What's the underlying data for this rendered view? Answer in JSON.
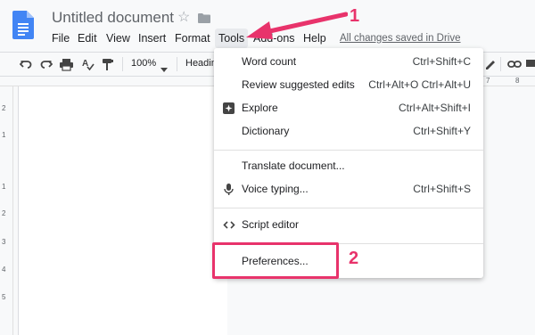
{
  "app": {
    "title": "Untitled document",
    "icons": [
      "docs-logo-icon",
      "star-icon",
      "folder-icon"
    ]
  },
  "menubar": {
    "items": [
      "File",
      "Edit",
      "View",
      "Insert",
      "Format",
      "Tools",
      "Add-ons",
      "Help"
    ],
    "active": "Tools",
    "saved_status": "All changes saved in Drive"
  },
  "toolbar": {
    "zoom": "100%",
    "style": "Headin",
    "icons": [
      "undo-icon",
      "redo-icon",
      "print-icon",
      "spellcheck-icon",
      "paint-format-icon",
      "pencil-icon",
      "link-icon",
      "comment-icon"
    ]
  },
  "ruler": {
    "left_numbers": [
      "2",
      "1",
      "1",
      "2",
      "3",
      "4",
      "5"
    ],
    "top_numbers": [
      "7",
      "8"
    ]
  },
  "tools_menu": {
    "items": [
      {
        "label": "Word count",
        "shortcut": "Ctrl+Shift+C",
        "icon": ""
      },
      {
        "label": "Review suggested edits",
        "shortcut": "Ctrl+Alt+O Ctrl+Alt+U",
        "icon": ""
      },
      {
        "label": "Explore",
        "shortcut": "Ctrl+Alt+Shift+I",
        "icon": "explore-icon"
      },
      {
        "label": "Dictionary",
        "shortcut": "Ctrl+Shift+Y",
        "icon": ""
      },
      {
        "label": "Translate document...",
        "shortcut": "",
        "icon": ""
      },
      {
        "label": "Voice typing...",
        "shortcut": "Ctrl+Shift+S",
        "icon": "microphone-icon"
      },
      {
        "label": "Script editor",
        "shortcut": "",
        "icon": "code-icon"
      },
      {
        "label": "Preferences...",
        "shortcut": "",
        "icon": ""
      }
    ]
  },
  "annotations": {
    "step1": "1",
    "step2": "2",
    "color": "#e8336b"
  }
}
